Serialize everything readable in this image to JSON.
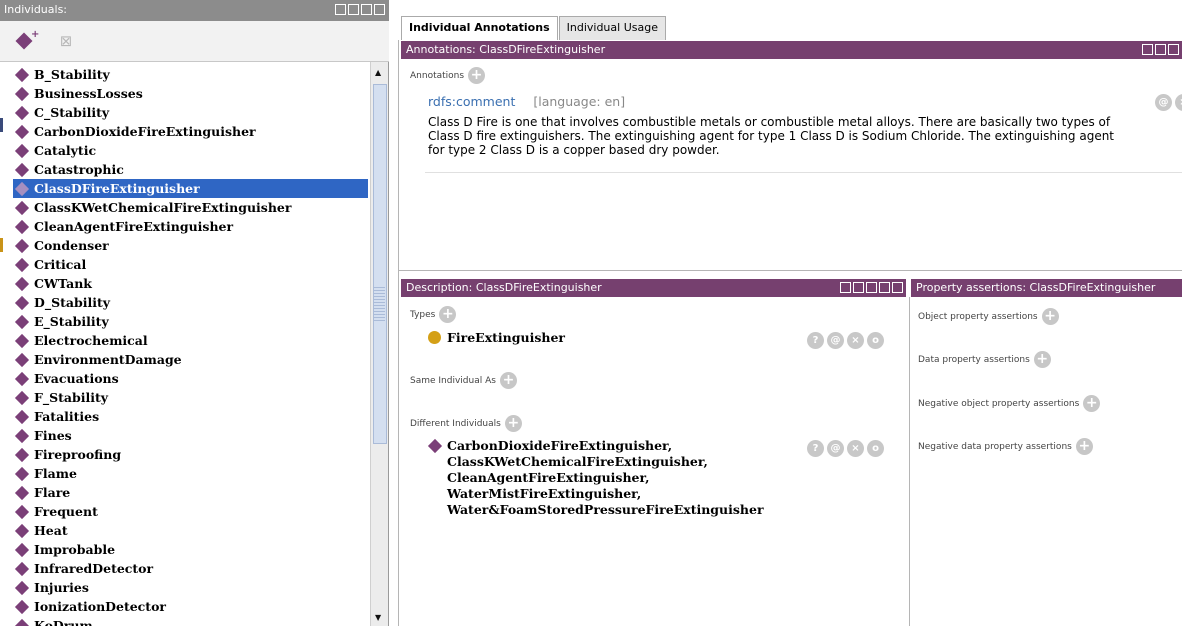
{
  "left_panel": {
    "title": "Individuals:",
    "items": [
      "B_Stability",
      "BusinessLosses",
      "C_Stability",
      "CarbonDioxideFireExtinguisher",
      "Catalytic",
      "Catastrophic",
      "ClassDFireExtinguisher",
      "ClassKWetChemicalFireExtinguisher",
      "CleanAgentFireExtinguisher",
      "Condenser",
      "Critical",
      "CWTank",
      "D_Stability",
      "E_Stability",
      "Electrochemical",
      "EnvironmentDamage",
      "Evacuations",
      "F_Stability",
      "Fatalities",
      "Fines",
      "Fireproofing",
      "Flame",
      "Flare",
      "Frequent",
      "Heat",
      "Improbable",
      "InfraredDetector",
      "Injuries",
      "IonizationDetector",
      "KoDrum"
    ],
    "selected_index": 6
  },
  "tabs": [
    "Individual Annotations",
    "Individual Usage"
  ],
  "annotations": {
    "header": "Annotations: ClassDFireExtinguisher",
    "label": "Annotations",
    "property": "rdfs:comment",
    "language": "[language: en]",
    "comment_lines": [
      "Class D Fire is one that involves combustible metals or combustible metal alloys. There are basically two types of",
      "Class D fire extinguishers. The extinguishing agent for type 1 Class D is Sodium Chloride. The extinguishing agent",
      "for type 2 Class D is a copper based dry powder."
    ]
  },
  "description": {
    "header": "Description: ClassDFireExtinguisher",
    "types_label": "Types",
    "type_value": "FireExtinguisher",
    "same_label": "Same Individual As",
    "different_label": "Different Individuals",
    "different_values": [
      "CarbonDioxideFireExtinguisher,",
      "ClassKWetChemicalFireExtinguisher,",
      "CleanAgentFireExtinguisher,",
      "WaterMistFireExtinguisher,",
      "Water&FoamStoredPressureFireExtinguisher"
    ]
  },
  "property_assertions": {
    "header": "Property assertions: ClassDFireExtinguisher",
    "sections": [
      "Object property assertions",
      "Data property assertions",
      "Negative object property assertions",
      "Negative data property assertions"
    ]
  },
  "colors": {
    "panel_header": "#76406f",
    "individual_icon": "#7b3f78",
    "selection": "#2f66c4",
    "class_icon": "#d4a017"
  }
}
